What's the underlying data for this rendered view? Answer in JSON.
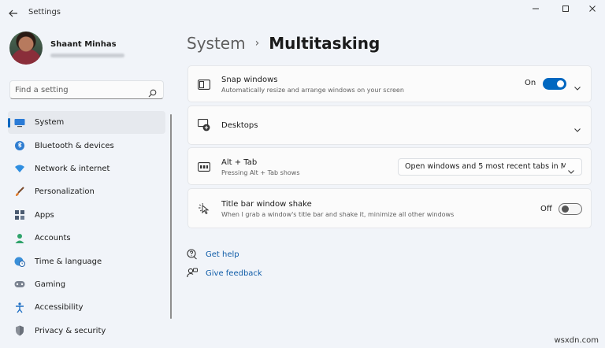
{
  "window": {
    "title": "Settings",
    "controls": [
      "minimize",
      "maximize",
      "close"
    ]
  },
  "user": {
    "name": "Shaant Minhas"
  },
  "search": {
    "placeholder": "Find a setting"
  },
  "sidebar": {
    "items": [
      {
        "label": "System",
        "icon": "monitor-icon",
        "selected": true
      },
      {
        "label": "Bluetooth & devices",
        "icon": "bluetooth-icon"
      },
      {
        "label": "Network & internet",
        "icon": "wifi-icon"
      },
      {
        "label": "Personalization",
        "icon": "brush-icon"
      },
      {
        "label": "Apps",
        "icon": "apps-icon"
      },
      {
        "label": "Accounts",
        "icon": "person-icon"
      },
      {
        "label": "Time & language",
        "icon": "globe-clock-icon"
      },
      {
        "label": "Gaming",
        "icon": "controller-icon"
      },
      {
        "label": "Accessibility",
        "icon": "accessibility-icon"
      },
      {
        "label": "Privacy & security",
        "icon": "shield-icon"
      }
    ]
  },
  "breadcrumb": {
    "parent": "System",
    "separator": "›",
    "current": "Multitasking"
  },
  "cards": {
    "snap": {
      "title": "Snap windows",
      "description": "Automatically resize and arrange windows on your screen",
      "toggle_label": "On",
      "toggle_on": true
    },
    "desktops": {
      "title": "Desktops"
    },
    "alttab": {
      "title": "Alt + Tab",
      "description": "Pressing Alt + Tab shows",
      "selected": "Open windows and 5 most recent tabs in M"
    },
    "shake": {
      "title": "Title bar window shake",
      "description": "When I grab a window's title bar and shake it, minimize all other windows",
      "toggle_label": "Off",
      "toggle_on": false
    }
  },
  "links": {
    "help": "Get help",
    "feedback": "Give feedback"
  },
  "watermark": "wsxdn.com",
  "colors": {
    "accent": "#0067c0",
    "background": "#f1f4f9",
    "card": "#fbfbfb",
    "link": "#0f5ca8"
  }
}
